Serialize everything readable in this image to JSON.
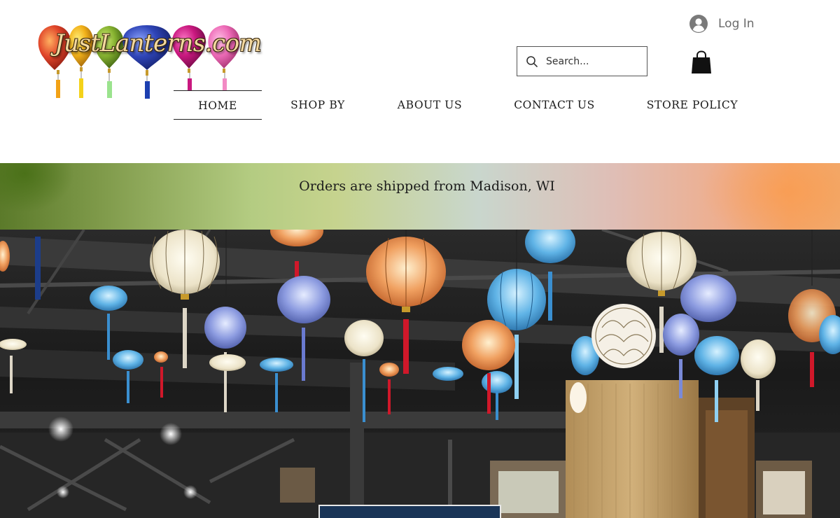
{
  "header": {
    "logo_text": "JustLanterns.com",
    "login_label": "Log In",
    "search_placeholder": "Search...",
    "cart_icon": "shopping-bag-icon"
  },
  "nav": {
    "items": [
      {
        "label": "HOME",
        "active": true
      },
      {
        "label": "SHOP BY",
        "active": false
      },
      {
        "label": "ABOUT US",
        "active": false
      },
      {
        "label": "CONTACT US",
        "active": false
      },
      {
        "label": "STORE POLICY",
        "active": false
      }
    ]
  },
  "banner": {
    "text": "Orders are shipped from Madison, WI"
  },
  "colors": {
    "cta_background": "#1a3557",
    "text_dark": "#1a1a1a",
    "login_gray": "#6b6b6b"
  }
}
